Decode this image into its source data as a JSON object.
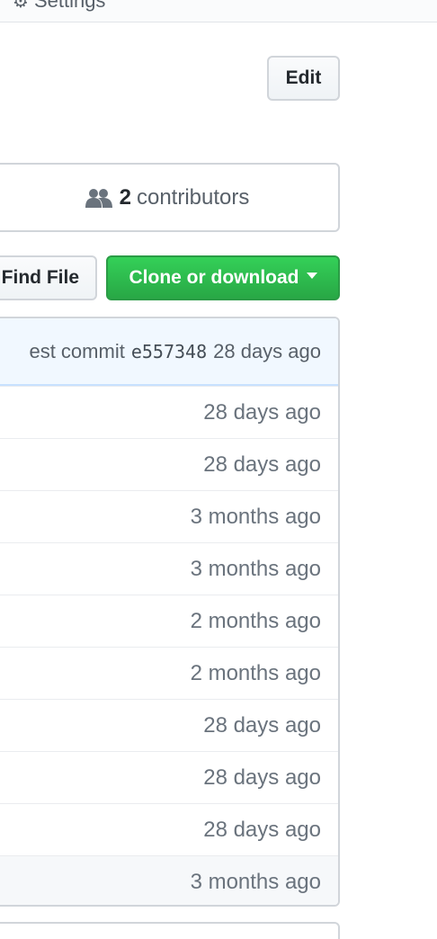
{
  "nav": {
    "settings_label": "Settings"
  },
  "buttons": {
    "edit": "Edit",
    "find_file": "Find File",
    "clone": "Clone or download"
  },
  "summary": {
    "contributors_count": "2",
    "contributors_label": "contributors"
  },
  "commit": {
    "prefix": "est commit",
    "sha": "e557348",
    "age": "28 days ago"
  },
  "files": [
    {
      "age": "28 days ago"
    },
    {
      "age": "28 days ago"
    },
    {
      "age": "3 months ago"
    },
    {
      "age": "3 months ago"
    },
    {
      "age": "2 months ago"
    },
    {
      "age": "2 months ago"
    },
    {
      "age": "28 days ago"
    },
    {
      "age": "28 days ago"
    },
    {
      "age": "28 days ago"
    },
    {
      "age": "3 months ago"
    }
  ],
  "colors": {
    "accent_green": "#28a745",
    "commit_bar_bg": "#f1f8ff",
    "border": "#d1d5da"
  }
}
